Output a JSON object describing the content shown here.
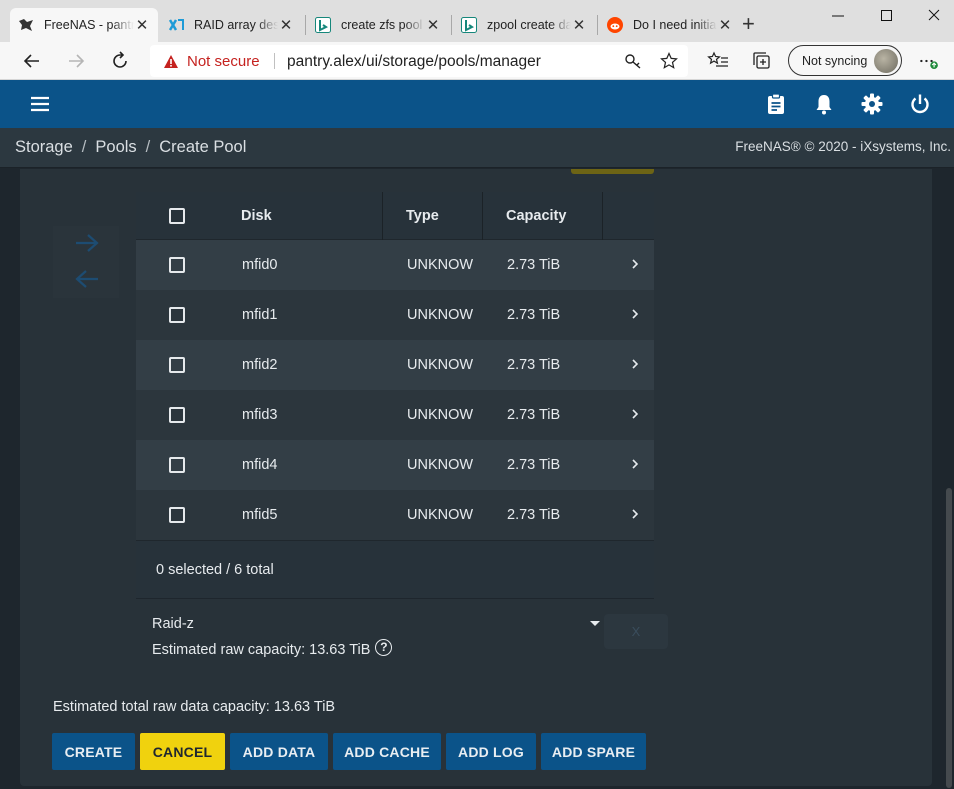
{
  "browser": {
    "tabs": [
      {
        "title": "FreeNAS - pantry.alex",
        "active": true,
        "favicon": "freenas-icon"
      },
      {
        "title": "RAID array design",
        "active": false,
        "favicon": "ixsystems-icon"
      },
      {
        "title": "create zfs pool",
        "active": false,
        "favicon": "bing-icon"
      },
      {
        "title": "zpool create da",
        "active": false,
        "favicon": "bing-icon"
      },
      {
        "title": "Do I need initia",
        "active": false,
        "favicon": "reddit-icon"
      }
    ],
    "security_label": "Not secure",
    "url": "pantry.alex/ui/storage/pools/manager",
    "sync_label": "Not syncing"
  },
  "header": {
    "icons": [
      "menu-icon",
      "clipboard-icon",
      "bell-icon",
      "gear-icon",
      "power-icon"
    ]
  },
  "breadcrumb": {
    "items": [
      "Storage",
      "Pools",
      "Create Pool"
    ],
    "separator": "/",
    "copyright": "FreeNAS® © 2020 - iXsystems, Inc."
  },
  "disk_table": {
    "columns": {
      "disk": "Disk",
      "type": "Type",
      "capacity": "Capacity"
    },
    "rows": [
      {
        "disk": "mfid0",
        "type": "UNKNOW",
        "capacity": "2.73 TiB"
      },
      {
        "disk": "mfid1",
        "type": "UNKNOW",
        "capacity": "2.73 TiB"
      },
      {
        "disk": "mfid2",
        "type": "UNKNOW",
        "capacity": "2.73 TiB"
      },
      {
        "disk": "mfid3",
        "type": "UNKNOW",
        "capacity": "2.73 TiB"
      },
      {
        "disk": "mfid4",
        "type": "UNKNOW",
        "capacity": "2.73 TiB"
      },
      {
        "disk": "mfid5",
        "type": "UNKNOW",
        "capacity": "2.73 TiB"
      }
    ],
    "footer": "0 selected / 6 total"
  },
  "vdev": {
    "layout": "Raid-z",
    "remove_label": "X",
    "estimated_capacity": "Estimated raw capacity: 13.63 TiB"
  },
  "total_capacity": "Estimated total raw data capacity: 13.63 TiB",
  "buttons": {
    "create": "CREATE",
    "cancel": "CANCEL",
    "add_data": "ADD DATA",
    "add_cache": "ADD CACHE",
    "add_log": "ADD LOG",
    "add_spare": "ADD SPARE"
  },
  "colors": {
    "header_blue": "#0b5389",
    "cancel_yellow": "#f0d20e",
    "panel": "#283239",
    "background": "#1e262d"
  }
}
